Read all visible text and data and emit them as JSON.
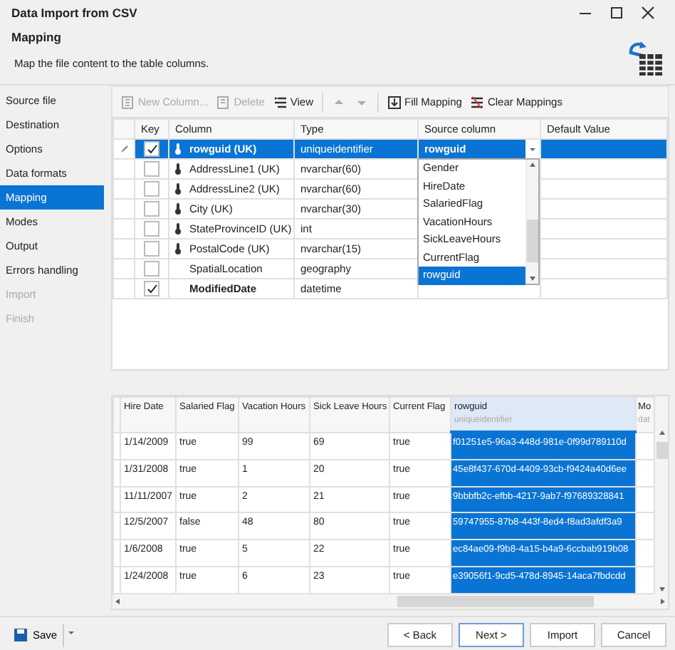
{
  "window": {
    "title": "Data Import from CSV"
  },
  "header": {
    "title": "Mapping",
    "description": "Map the file content to the table columns."
  },
  "sidebar": {
    "items": [
      {
        "label": "Source file",
        "selected": false,
        "disabled": false
      },
      {
        "label": "Destination",
        "selected": false,
        "disabled": false
      },
      {
        "label": "Options",
        "selected": false,
        "disabled": false
      },
      {
        "label": "Data formats",
        "selected": false,
        "disabled": false
      },
      {
        "label": "Mapping",
        "selected": true,
        "disabled": false
      },
      {
        "label": "Modes",
        "selected": false,
        "disabled": false
      },
      {
        "label": "Output",
        "selected": false,
        "disabled": false
      },
      {
        "label": "Errors handling",
        "selected": false,
        "disabled": false
      },
      {
        "label": "Import",
        "selected": false,
        "disabled": true
      },
      {
        "label": "Finish",
        "selected": false,
        "disabled": true
      }
    ]
  },
  "toolbar": {
    "buttons": [
      {
        "kind": "new-column",
        "label": "New Column...",
        "disabled": true
      },
      {
        "kind": "delete",
        "label": "Delete",
        "disabled": true
      },
      {
        "kind": "view",
        "label": "View",
        "disabled": false
      },
      {
        "kind": "move-up",
        "disabled": true
      },
      {
        "kind": "move-down",
        "disabled": true
      },
      {
        "kind": "fill",
        "label": "Fill Mapping",
        "disabled": false
      },
      {
        "kind": "clear",
        "label": "Clear Mappings",
        "disabled": false
      }
    ]
  },
  "mapping_table": {
    "columns": [
      "Key",
      "Column",
      "Type",
      "Source column",
      "Default Value"
    ],
    "rows": [
      {
        "key": true,
        "indexed": true,
        "bold": true,
        "selected": true,
        "column": "rowguid (UK)",
        "type": "uniqueidentifier",
        "source": "rowguid"
      },
      {
        "key": false,
        "indexed": true,
        "bold": false,
        "selected": false,
        "column": "AddressLine1 (UK)",
        "type": "nvarchar(60)"
      },
      {
        "key": false,
        "indexed": true,
        "bold": false,
        "selected": false,
        "column": "AddressLine2 (UK)",
        "type": "nvarchar(60)"
      },
      {
        "key": false,
        "indexed": true,
        "bold": false,
        "selected": false,
        "column": "City (UK)",
        "type": "nvarchar(30)"
      },
      {
        "key": false,
        "indexed": true,
        "bold": false,
        "selected": false,
        "column": "StateProvinceID (UK)",
        "type": "int"
      },
      {
        "key": false,
        "indexed": true,
        "bold": false,
        "selected": false,
        "column": "PostalCode (UK)",
        "type": "nvarchar(15)"
      },
      {
        "key": false,
        "indexed": false,
        "bold": false,
        "selected": false,
        "column": "SpatialLocation",
        "type": "geography"
      },
      {
        "key": true,
        "indexed": false,
        "bold": true,
        "selected": false,
        "column": "ModifiedDate",
        "type": "datetime"
      }
    ],
    "dropdown": {
      "items": [
        {
          "label": "Gender",
          "selected": false
        },
        {
          "label": "HireDate",
          "selected": false
        },
        {
          "label": "SalariedFlag",
          "selected": false
        },
        {
          "label": "VacationHours",
          "selected": false
        },
        {
          "label": "SickLeaveHours",
          "selected": false
        },
        {
          "label": "CurrentFlag",
          "selected": false
        },
        {
          "label": "rowguid",
          "selected": true
        }
      ]
    }
  },
  "preview_table": {
    "columns": [
      {
        "label": "Hire Date",
        "selected": false
      },
      {
        "label": "Salaried Flag",
        "selected": false
      },
      {
        "label": "Vacation Hours",
        "selected": false
      },
      {
        "label": "Sick Leave Hours",
        "selected": false
      },
      {
        "label": "Current Flag",
        "selected": false
      },
      {
        "label": "rowguid",
        "sublabel": "uniqueidentifier",
        "selected": true
      },
      {
        "label": "Mo",
        "sublabel": "dat",
        "selected": false
      }
    ],
    "rows": [
      [
        "1/14/2009",
        "true",
        "99",
        "69",
        "true",
        "f01251e5-96a3-448d-981e-0f99d789110d"
      ],
      [
        "1/31/2008",
        "true",
        "1",
        "20",
        "true",
        "45e8f437-670d-4409-93cb-f9424a40d6ee"
      ],
      [
        "11/11/2007",
        "true",
        "2",
        "21",
        "true",
        "9bbbfb2c-efbb-4217-9ab7-f97689328841"
      ],
      [
        "12/5/2007",
        "false",
        "48",
        "80",
        "true",
        "59747955-87b8-443f-8ed4-f8ad3afdf3a9"
      ],
      [
        "1/6/2008",
        "true",
        "5",
        "22",
        "true",
        "ec84ae09-f9b8-4a15-b4a9-6ccbab919b08"
      ],
      [
        "1/24/2008",
        "true",
        "6",
        "23",
        "true",
        "e39056f1-9cd5-478d-8945-14aca7fbdcdd"
      ]
    ]
  },
  "footer": {
    "save": "Save",
    "buttons": [
      {
        "label": "< Back",
        "default": false
      },
      {
        "label": "Next >",
        "default": true
      },
      {
        "label": "Import",
        "default": false
      },
      {
        "label": "Cancel",
        "default": false
      }
    ]
  }
}
